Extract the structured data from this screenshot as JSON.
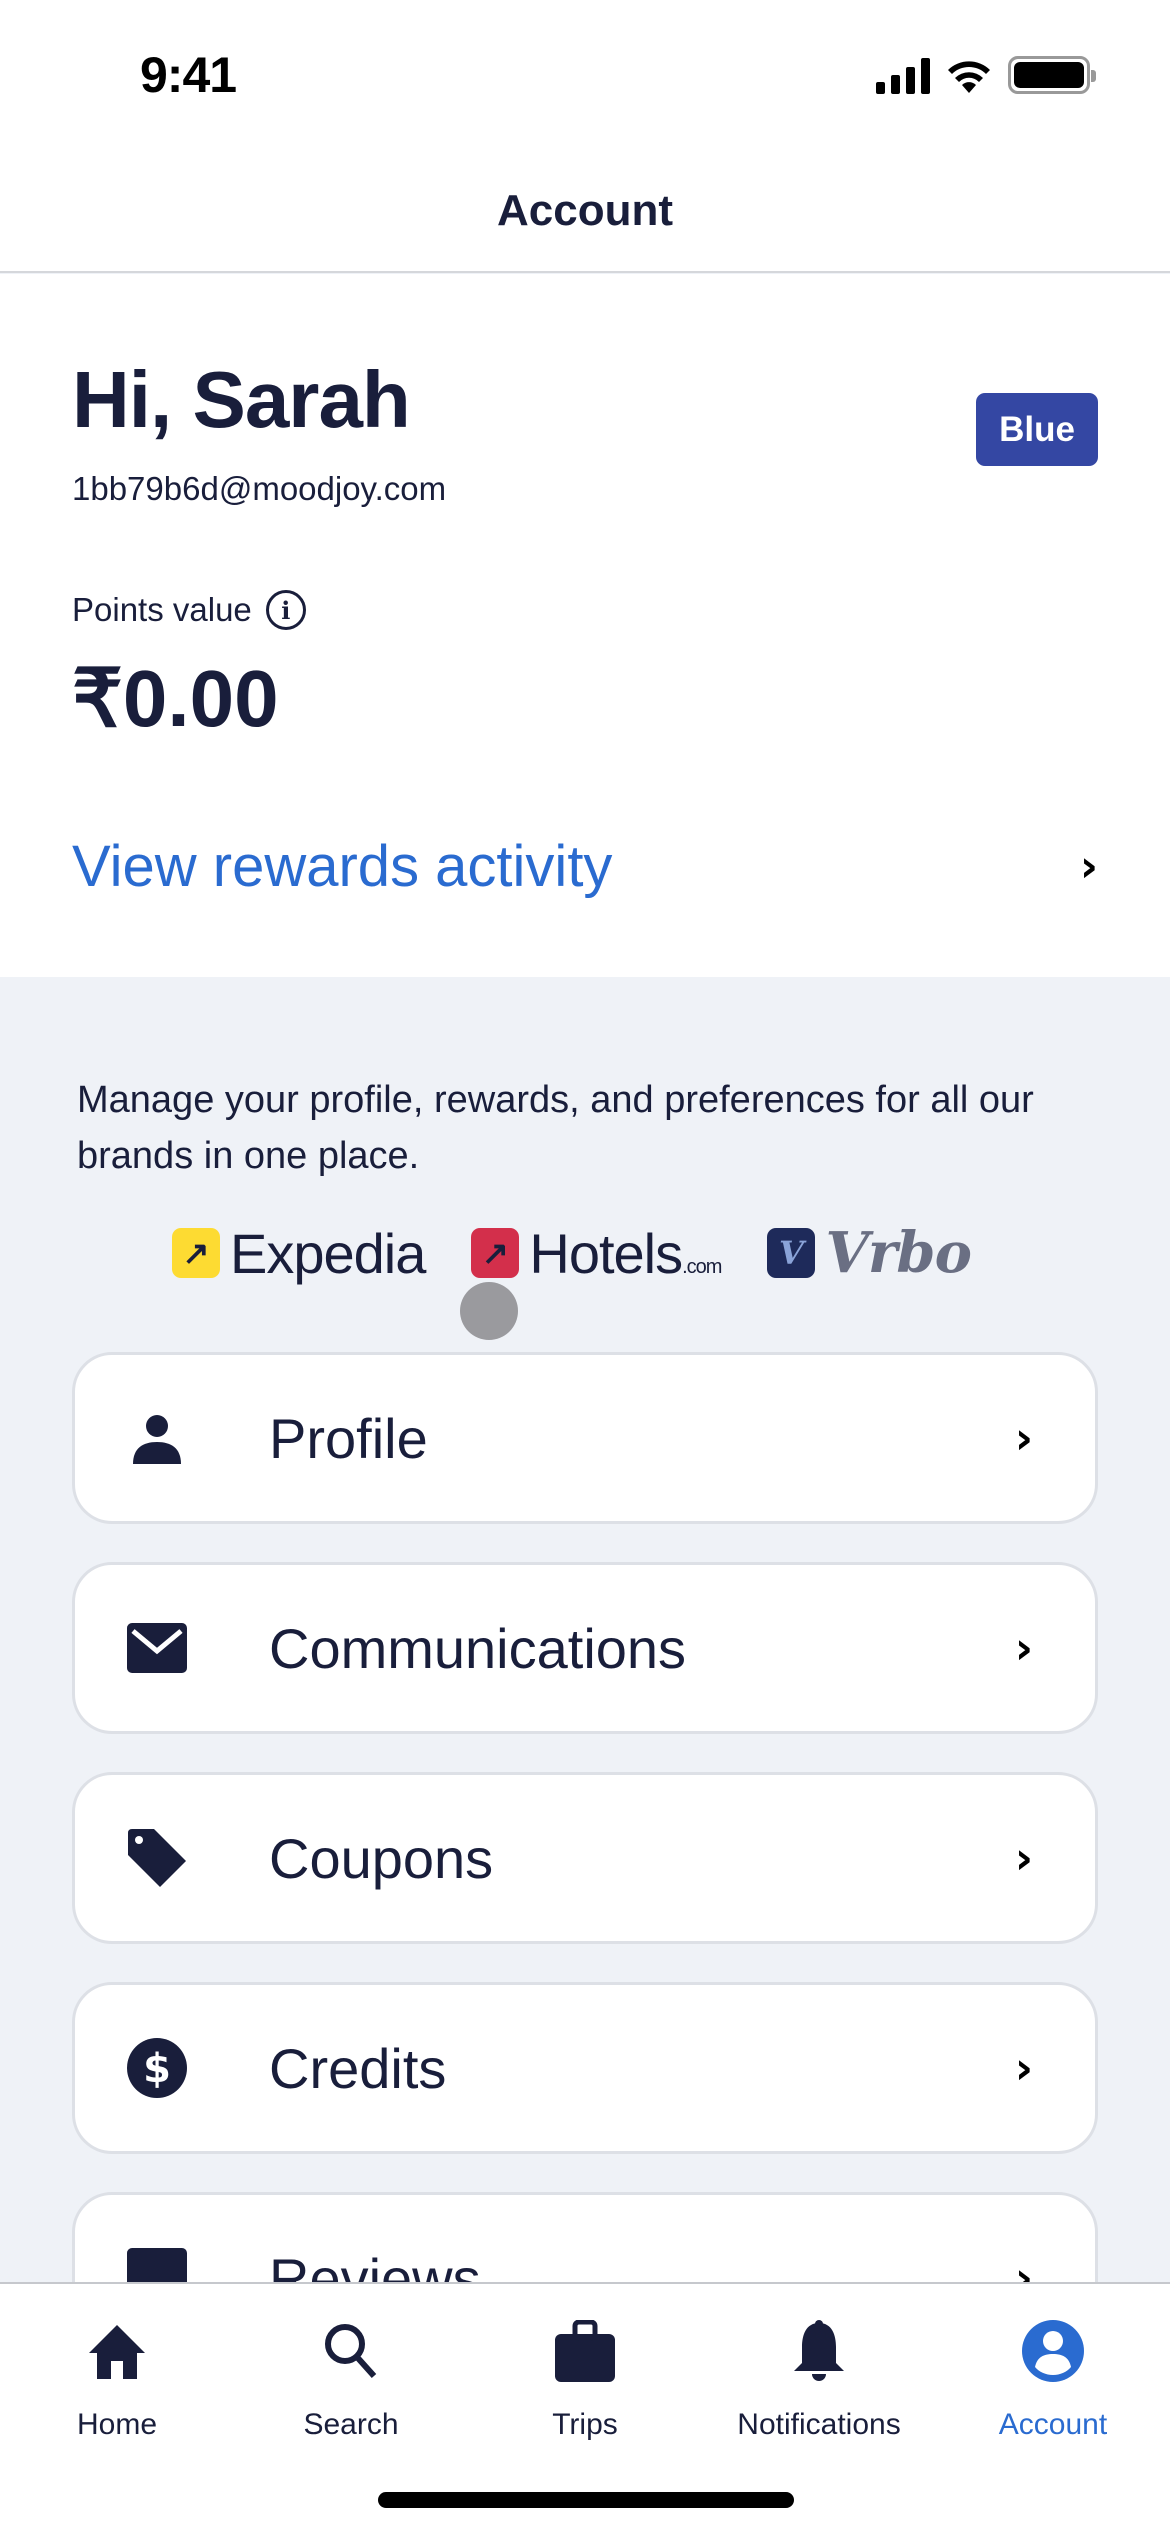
{
  "status_bar": {
    "time": "9:41"
  },
  "header": {
    "title": "Account"
  },
  "summary": {
    "greeting": "Hi, Sarah",
    "email": "1bb79b6d@moodjoy.com",
    "tier_badge": "Blue",
    "points_label": "Points value",
    "points_value": "₹0.00",
    "rewards_link": "View rewards activity"
  },
  "colors": {
    "accent": "#2a6bd0",
    "badge": "#3447a3",
    "text": "#191e3b",
    "background": "#eff2f7"
  },
  "manage_text": "Manage your profile, rewards, and preferences for all our brands in one place.",
  "brands": [
    {
      "name": "Expedia",
      "suffix": ""
    },
    {
      "name": "Hotels",
      "suffix": ".com"
    },
    {
      "name": "Vrbo",
      "suffix": ""
    }
  ],
  "menu": [
    {
      "label": "Profile",
      "icon": "person-icon"
    },
    {
      "label": "Communications",
      "icon": "envelope-icon"
    },
    {
      "label": "Coupons",
      "icon": "tag-icon"
    },
    {
      "label": "Credits",
      "icon": "dollar-circle-icon"
    },
    {
      "label": "Reviews",
      "icon": "reviews-icon"
    }
  ],
  "tabs": [
    {
      "label": "Home",
      "icon": "home-icon",
      "active": false
    },
    {
      "label": "Search",
      "icon": "search-icon",
      "active": false
    },
    {
      "label": "Trips",
      "icon": "briefcase-icon",
      "active": false
    },
    {
      "label": "Notifications",
      "icon": "bell-icon",
      "active": false
    },
    {
      "label": "Account",
      "icon": "account-icon",
      "active": true
    }
  ]
}
